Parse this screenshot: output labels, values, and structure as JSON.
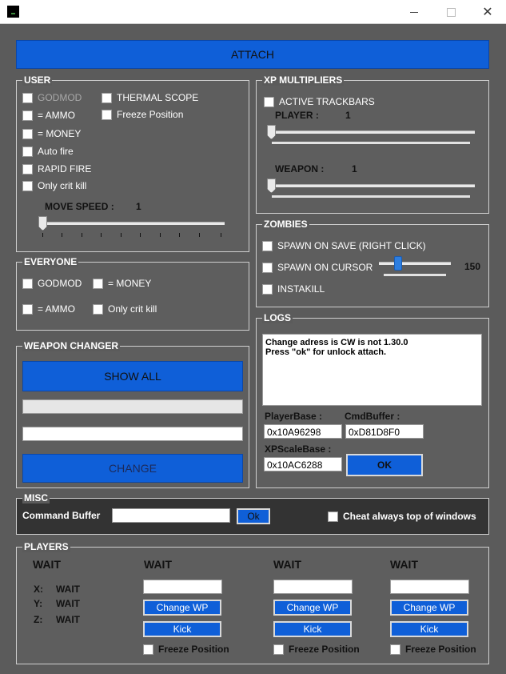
{
  "window": {
    "minimize": "",
    "maximize": "",
    "close": "✕"
  },
  "attach_label": "ATTACH",
  "user": {
    "title": "USER",
    "checks_left": [
      "GODMOD",
      "= AMMO",
      "= MONEY",
      "Auto fire",
      "RAPID FIRE",
      "Only crit kill"
    ],
    "checks_right": [
      "THERMAL SCOPE",
      "Freeze Position"
    ],
    "move_speed_label": "MOVE SPEED :",
    "move_speed_value": "1"
  },
  "xp": {
    "title": "XP MULTIPLIERS",
    "active_label": "ACTIVE TRACKBARS",
    "player_label": "PLAYER :",
    "player_value": "1",
    "weapon_label": "WEAPON :",
    "weapon_value": "1"
  },
  "zombies": {
    "title": "ZOMBIES",
    "spawn_save": "SPAWN ON SAVE (RIGHT CLICK)",
    "spawn_cursor": "SPAWN ON CURSOR",
    "cursor_value": "150",
    "instakill": "INSTAKILL"
  },
  "everyone": {
    "title": "EVERYONE",
    "godmod": "GODMOD",
    "money": "= MONEY",
    "ammo": "= AMMO",
    "crit": "Only crit kill"
  },
  "logs": {
    "title": "LOGS",
    "line1": "Change adress is CW is not 1.30.0",
    "line2": "Press \"ok\" for unlock attach.",
    "player_base_label": "PlayerBase :",
    "player_base_value": "0x10A96298",
    "cmd_buffer_label": "CmdBuffer :",
    "cmd_buffer_value": "0xD81D8F0",
    "xp_scale_label": "XPScaleBase :",
    "xp_scale_value": "0x10AC6288",
    "ok_label": "OK"
  },
  "weapon_changer": {
    "title": "WEAPON CHANGER",
    "show_all": "SHOW ALL",
    "change": "CHANGE"
  },
  "misc": {
    "title": "MISC",
    "command_buffer_label": "Command Buffer",
    "ok_label": "Ok",
    "top_label": "Cheat always top of windows"
  },
  "players": {
    "title": "PLAYERS",
    "first": {
      "name": "WAIT",
      "x_label": "X:",
      "x_value": "WAIT",
      "y_label": "Y:",
      "y_value": "WAIT",
      "z_label": "Z:",
      "z_value": "WAIT"
    },
    "others": [
      {
        "name": "WAIT",
        "change_wp": "Change WP",
        "kick": "Kick",
        "freeze": "Freeze Position"
      },
      {
        "name": "WAIT",
        "change_wp": "Change WP",
        "kick": "Kick",
        "freeze": "Freeze Position"
      },
      {
        "name": "WAIT",
        "change_wp": "Change WP",
        "kick": "Kick",
        "freeze": "Freeze Position"
      }
    ]
  }
}
